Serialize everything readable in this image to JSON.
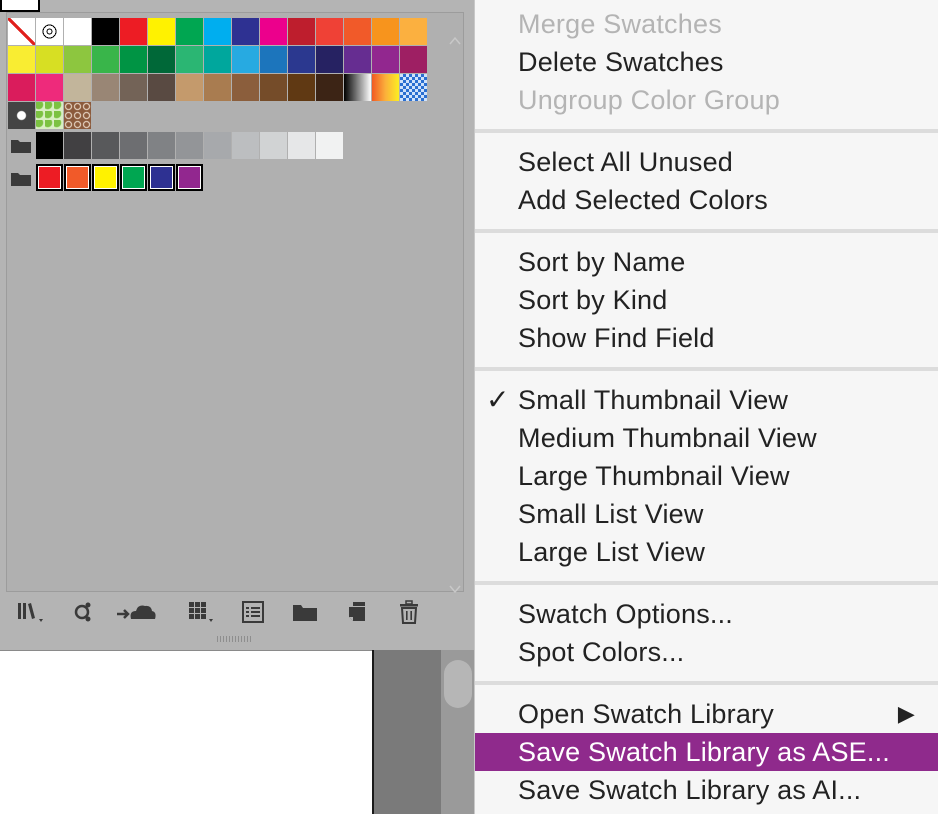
{
  "swatches_panel": {
    "rows": [
      [
        "none",
        "registration",
        "#ffffff",
        "#000000",
        "#ed1c24",
        "#fff200",
        "#00a651",
        "#00aeef",
        "#2e3192",
        "#ec008c",
        "#be1e2d",
        "#ef4136",
        "#f15a29",
        "#f7941d",
        "#fbb040"
      ],
      [
        "#f9ed32",
        "#d7df23",
        "#8dc63f",
        "#39b54a",
        "#009444",
        "#006838",
        "#2bb673",
        "#00a79d",
        "#27aae1",
        "#1c75bc",
        "#2b388f",
        "#262262",
        "#662d91",
        "#92278f",
        "#9e1f63"
      ],
      [
        "#da1c5c",
        "#ee2a7b",
        "#c2b59b",
        "#998675",
        "#736357",
        "#594a42",
        "#c49a6c",
        "#a97c50",
        "#8b5e3c",
        "#754c29",
        "#603913",
        "#3c2415",
        "gradient-bw",
        "gradient-orange",
        "pattern-checker"
      ],
      [
        "pattern-dots",
        "pattern-leaves",
        "pattern-swirl"
      ]
    ],
    "gray_group": [
      "#000000",
      "#414042",
      "#58595b",
      "#6d6e71",
      "#808285",
      "#939598",
      "#a7a9ac",
      "#bcbec0",
      "#d1d3d4",
      "#e6e7e8",
      "#f1f2f2"
    ],
    "color_group": [
      "#ed1c24",
      "#f15a29",
      "#fff200",
      "#00a651",
      "#2e3192",
      "#92278f"
    ],
    "toolbar_icons": [
      "swatch-libraries-menu-icon",
      "show-swatch-kinds-icon",
      "add-to-cc-library-icon",
      "swatch-options-grid-icon",
      "show-swatch-list-icon",
      "new-color-group-icon",
      "new-swatch-icon",
      "delete-swatch-icon"
    ]
  },
  "menu": {
    "items": [
      {
        "label": "Merge Swatches",
        "disabled": true
      },
      {
        "label": "Delete Swatches",
        "disabled": false
      },
      {
        "label": "Ungroup Color Group",
        "disabled": true
      },
      {
        "label": "Select All Unused",
        "disabled": false
      },
      {
        "label": "Add Selected Colors",
        "disabled": false
      },
      {
        "label": "Sort by Name",
        "disabled": false
      },
      {
        "label": "Sort by Kind",
        "disabled": false
      },
      {
        "label": "Show Find Field",
        "disabled": false
      },
      {
        "label": "Small Thumbnail View",
        "disabled": false,
        "checked": true
      },
      {
        "label": "Medium Thumbnail View",
        "disabled": false
      },
      {
        "label": "Large Thumbnail View",
        "disabled": false
      },
      {
        "label": "Small List View",
        "disabled": false
      },
      {
        "label": "Large List View",
        "disabled": false
      },
      {
        "label": "Swatch Options...",
        "disabled": false
      },
      {
        "label": "Spot Colors...",
        "disabled": false
      },
      {
        "label": "Open Swatch Library",
        "disabled": false,
        "submenu": true
      },
      {
        "label": "Save Swatch Library as ASE...",
        "disabled": false,
        "highlighted": true
      },
      {
        "label": "Save Swatch Library as AI...",
        "disabled": false
      }
    ],
    "check_glyph": "✓",
    "submenu_glyph": "▶",
    "highlight_color": "#8f2a8c"
  }
}
